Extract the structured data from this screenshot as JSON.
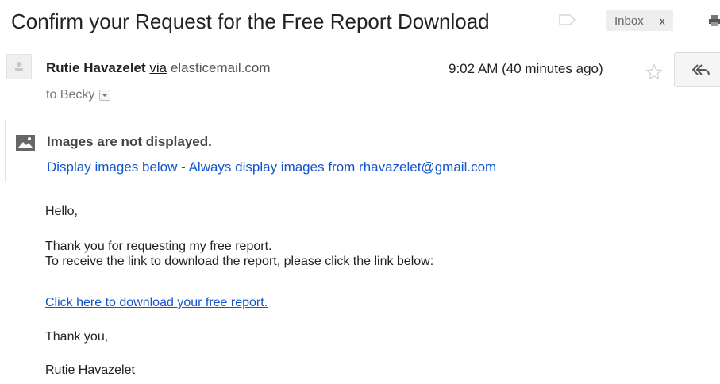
{
  "subject": "Confirm your Request for the Free Report Download",
  "labels": {
    "inbox": "Inbox",
    "remove": "x"
  },
  "sender": {
    "name": "Rutie Havazelet",
    "via": "via",
    "domain": "elasticemail.com",
    "to": "to Becky",
    "timestamp": "9:02 AM (40 minutes ago)"
  },
  "images_notice": {
    "title": "Images are not displayed.",
    "display_below": "Display images below",
    "separator": " - ",
    "always_display": "Always display images from rhavazelet@gmail.com"
  },
  "body": {
    "greeting": "Hello,",
    "line1": "Thank you for requesting my free report.",
    "line2": "To receive the link to download the report, please click the link below:",
    "link": "Click here to download your free report.",
    "thanks": "Thank you,",
    "signature": "Rutie Havazelet"
  },
  "icons": {
    "label": "label-icon",
    "print": "print-icon",
    "avatar": "avatar-icon",
    "star": "star-icon",
    "reply": "reply-icon",
    "image": "image-icon"
  },
  "colors": {
    "link": "#1155cc",
    "tag_bg": "#eeeeee",
    "text": "#222222"
  }
}
